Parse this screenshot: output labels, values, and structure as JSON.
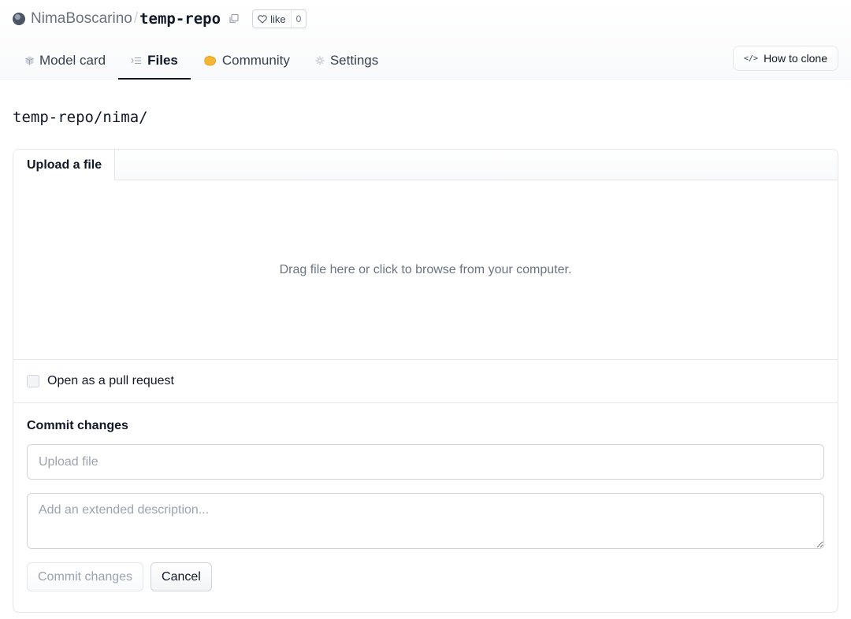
{
  "repo": {
    "owner": "NimaBoscarino",
    "separator": "/",
    "name": "temp-repo",
    "like_label": "like",
    "like_count": "0"
  },
  "tabs": [
    {
      "label": "Model card",
      "icon": "cube-icon"
    },
    {
      "label": "Files",
      "icon": "files-icon",
      "active": true
    },
    {
      "label": "Community",
      "icon": "community-icon"
    },
    {
      "label": "Settings",
      "icon": "gear-icon"
    }
  ],
  "clone": {
    "label": "How to clone",
    "icon": "code-icon"
  },
  "path": "temp-repo/nima/",
  "upload": {
    "tab_label": "Upload a file",
    "dropzone_text": "Drag file here or click to browse from your computer.",
    "pr_label": "Open as a pull request",
    "pr_checked": false
  },
  "commit": {
    "title": "Commit changes",
    "summary_placeholder": "Upload file",
    "description_placeholder": "Add an extended description...",
    "commit_button": "Commit changes",
    "cancel_button": "Cancel"
  },
  "colors": {
    "community_icon": "#f5b731",
    "text_primary": "#111827",
    "text_muted": "#6b7280"
  }
}
